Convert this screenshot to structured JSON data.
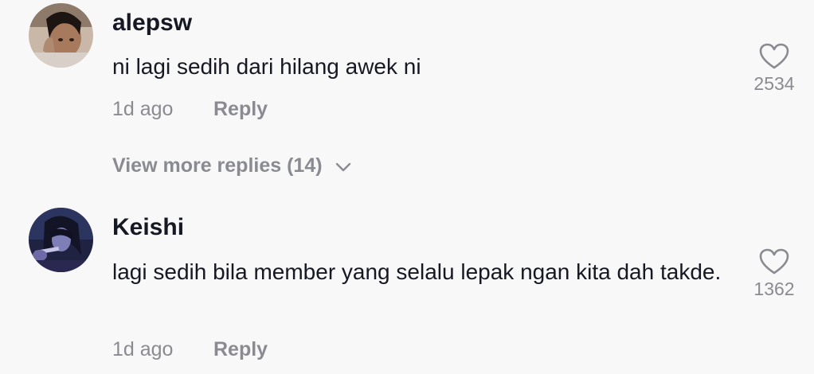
{
  "comments": [
    {
      "username": "alepsw",
      "text": "ni lagi sedih dari hilang awek ni",
      "time": "1d ago",
      "reply_label": "Reply",
      "likes": "2534"
    },
    {
      "username": "Keishi",
      "text": "lagi sedih bila member yang selalu lepak ngan kita dah takde.",
      "time": "1d ago",
      "reply_label": "Reply",
      "likes": "1362"
    }
  ],
  "view_more_replies": "View more replies (14)",
  "icons": {
    "like": "heart-outline-icon",
    "expand": "chevron-down-icon"
  },
  "colors": {
    "background": "#f8f8f8",
    "primary_text": "#161823",
    "secondary_text": "#8a8b91"
  }
}
